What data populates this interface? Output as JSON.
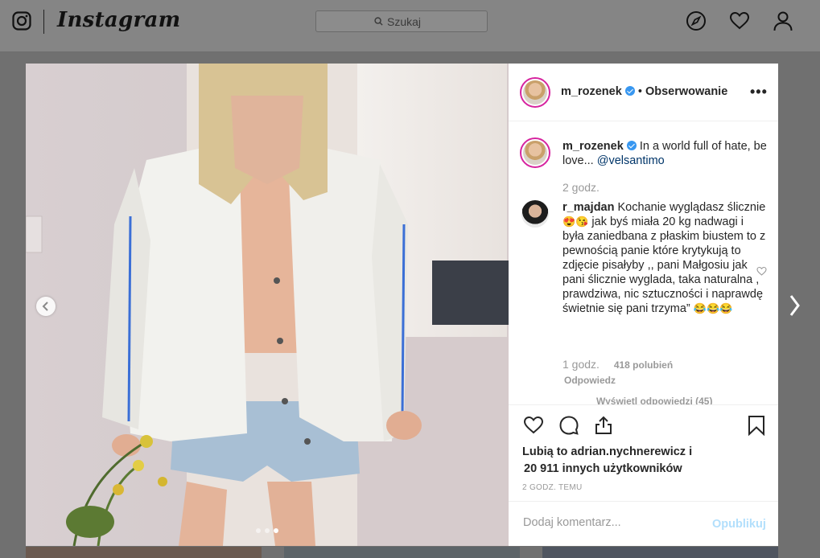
{
  "header": {
    "logo_text": "Instagram",
    "search_placeholder": "Szukaj",
    "nav_icons": [
      "explore-icon",
      "heart-icon",
      "profile-icon"
    ]
  },
  "post": {
    "author": "m_rozenek",
    "follow_label": "Obserwowanie",
    "follow_separator": "•",
    "more_label": "•••",
    "caption": "In a world full of hate, be love...",
    "caption_mention": "@velsantimo",
    "caption_time": "2 godz.",
    "carousel": {
      "slides": 3,
      "active_slide": 3
    }
  },
  "comments": [
    {
      "user": "r_majdan",
      "text_1": "Kochanie wyglądasz ślicznie",
      "emoji_1": "😍😘",
      "text_2": "jak byś miała 20 kg nadwagi i była zaniedbana z płaskim biustem to z pewnością panie które krytykują to zdjęcie pisałyby ,, pani Małgosiu jak pani ślicznie wyglada, taka naturalna , prawdziwa, nic sztuczności i naprawdę świetnie się pani trzyma”",
      "emoji_2": "😂😂😂",
      "time": "1 godz.",
      "likes": "418 polubień",
      "reply_label": "Odpowiedz",
      "view_replies": "Wyświetl odpowiedzi (45)"
    }
  ],
  "likes": {
    "line1_prefix": "Lubią to",
    "line1_user": "adrian.nychnerewicz",
    "line1_suffix": "i",
    "line2": "20 911 innych użytkowników"
  },
  "timestamp": "2 GODZ. TEMU",
  "comment_box": {
    "placeholder": "Dodaj komentarz...",
    "publish_label": "Opublikuj"
  },
  "colors": {
    "overlay": "#707070",
    "verified": "#3897f0",
    "publish_disabled": "#b2dffc",
    "mention": "#003569"
  }
}
